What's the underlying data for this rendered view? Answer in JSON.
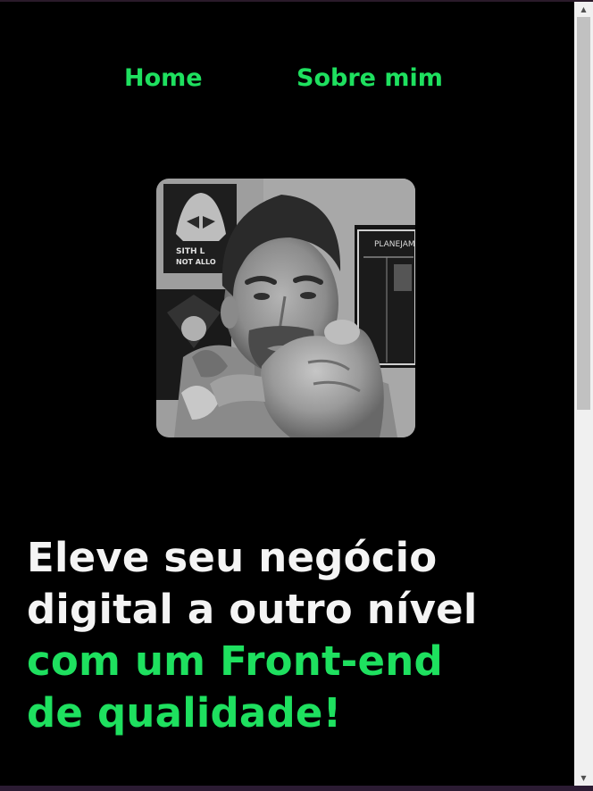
{
  "nav": {
    "home_label": "Home",
    "about_label": "Sobre mim"
  },
  "profile_photo": {
    "alt": "",
    "poster_text_1": "SITH L",
    "poster_text_2": "NOT ALLO",
    "board_text": "PLANEJAM"
  },
  "hero": {
    "line1": "Eleve seu negócio",
    "line2": "digital a outro nível",
    "line3": "com um Front-end",
    "line4": "de qualidade!"
  },
  "colors": {
    "background": "#000000",
    "accent_green": "#1ee05f",
    "headline_white": "#f4f4f4"
  },
  "scrollbar": {
    "up_icon": "triangle-up-icon",
    "down_icon": "triangle-down-icon"
  }
}
